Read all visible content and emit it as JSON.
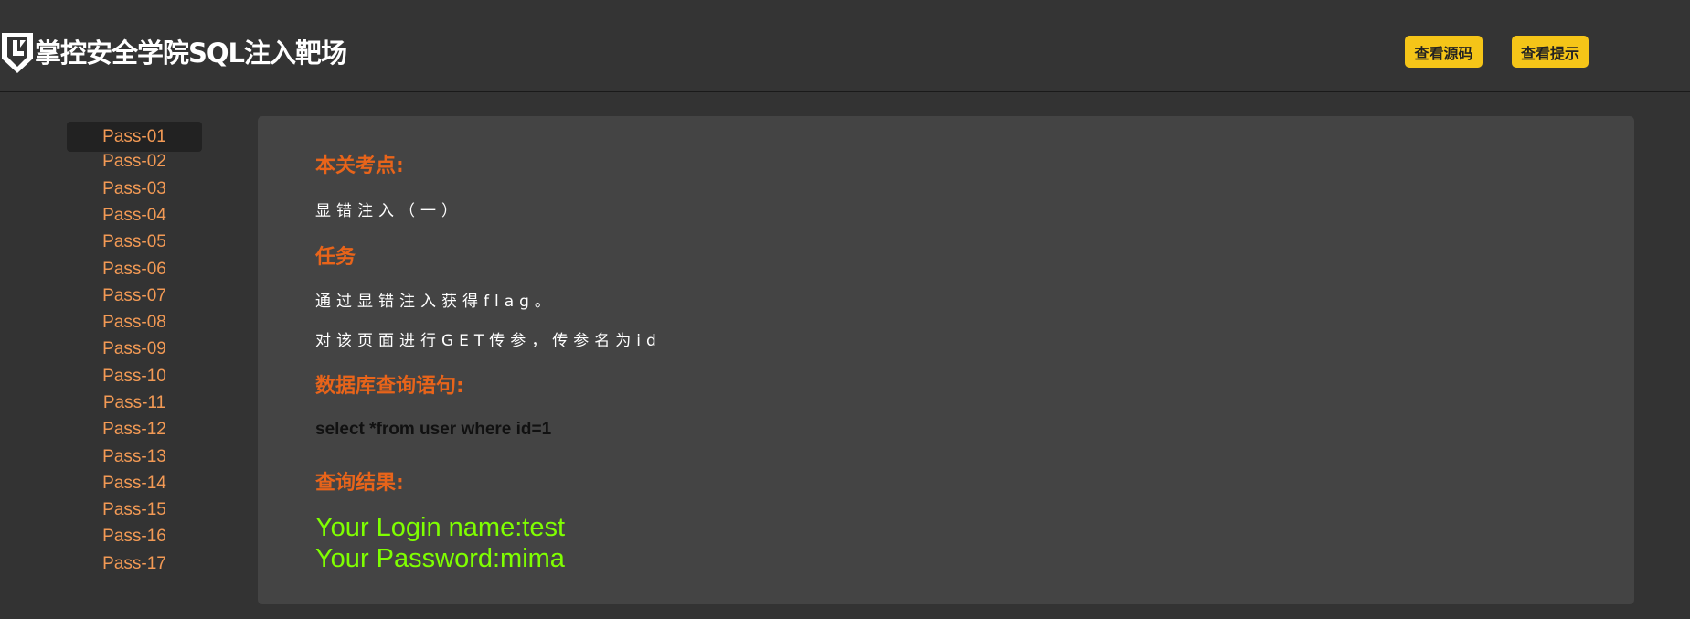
{
  "header": {
    "title": "掌控安全学院SQL注入靶场",
    "buttons": {
      "source": "查看源码",
      "hint": "查看提示"
    },
    "accent_color": "#f5c518"
  },
  "sidebar": {
    "items": [
      {
        "label": "Pass-01",
        "active": true
      },
      {
        "label": "Pass-02"
      },
      {
        "label": "Pass-03"
      },
      {
        "label": "Pass-04"
      },
      {
        "label": "Pass-05"
      },
      {
        "label": "Pass-06"
      },
      {
        "label": "Pass-07"
      },
      {
        "label": "Pass-08"
      },
      {
        "label": "Pass-09"
      },
      {
        "label": "Pass-10"
      },
      {
        "label": "Pass-11"
      },
      {
        "label": "Pass-12"
      },
      {
        "label": "Pass-13"
      },
      {
        "label": "Pass-14"
      },
      {
        "label": "Pass-15"
      },
      {
        "label": "Pass-16"
      },
      {
        "label": "Pass-17"
      }
    ]
  },
  "main": {
    "key_point_title": "本关考点:",
    "key_point_text": "显错注入（一）",
    "task_title": "任务",
    "task_lines": [
      "通过显错注入获得flag。",
      "对该页面进行GET传参，传参名为id"
    ],
    "query_title": "数据库查询语句:",
    "query_text": "select *from user where id=1",
    "result_title": "查询结果:",
    "result_lines": [
      "Your Login name:test",
      "Your Password:mima"
    ],
    "title_color": "#e8641a",
    "result_color": "#7fff00"
  }
}
